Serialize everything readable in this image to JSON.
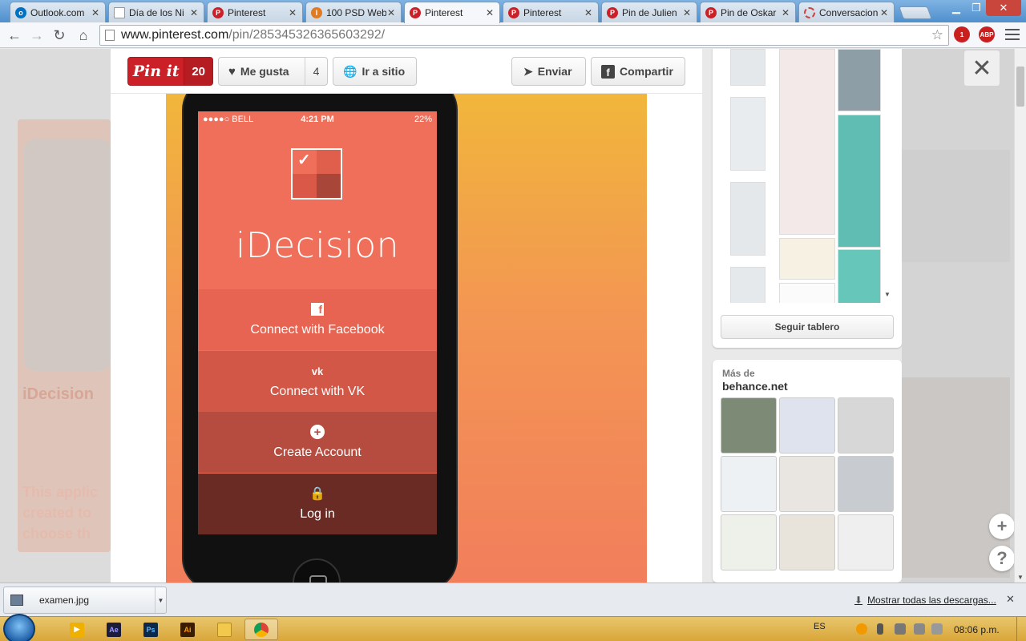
{
  "browser": {
    "tabs": [
      {
        "label": "Outlook.com",
        "icon": "outlook-icon",
        "color": "#0072c6"
      },
      {
        "label": "Día de los Ni",
        "icon": "page-icon",
        "color": "#999999"
      },
      {
        "label": "Pinterest",
        "icon": "pinterest-icon",
        "color": "#cb2027"
      },
      {
        "label": "100 PSD Web",
        "icon": "site-icon",
        "color": "#e07b24"
      },
      {
        "label": "Pinterest",
        "icon": "pinterest-icon",
        "color": "#cb2027",
        "active": true
      },
      {
        "label": "Pinterest",
        "icon": "pinterest-icon",
        "color": "#cb2027"
      },
      {
        "label": "Pin de Julien",
        "icon": "pinterest-icon",
        "color": "#cb2027"
      },
      {
        "label": "Pin de Oskar",
        "icon": "pinterest-icon",
        "color": "#cb2027"
      },
      {
        "label": "Conversacion",
        "icon": "loading-icon",
        "color": "#cc4444"
      }
    ],
    "url_host": "www.pinterest.com",
    "url_path": "/pin/285345326365603292/",
    "ext_badge": "1",
    "ext_abp": "ABP"
  },
  "pin_actions": {
    "pinit_label": "Pin it",
    "pinit_count": "20",
    "like_label": "Me gusta",
    "like_count": "4",
    "visit_label": "Ir a sitio",
    "send_label": "Enviar",
    "share_label": "Compartir"
  },
  "app_mock": {
    "carrier": "●●●●○ BELL",
    "time": "4:21 PM",
    "battery": "22%",
    "title": "iDecision",
    "menu": [
      {
        "label": "Connect with Facebook",
        "icon": "facebook-icon"
      },
      {
        "label": "Connect with VK",
        "icon": "vk-icon"
      },
      {
        "label": "Create Account",
        "icon": "plus-circle-icon"
      },
      {
        "label": "Log in",
        "icon": "lock-icon"
      }
    ]
  },
  "sidebar": {
    "follow_board": "Seguir tablero",
    "more_from_label": "Más de",
    "more_from_site": "behance.net"
  },
  "background": {
    "ghost_title": "iDecision",
    "ghost_text": "This applic created to choose th"
  },
  "downloads": {
    "file": "examen.jpg",
    "show_all": "Mostrar todas las descargas..."
  },
  "taskbar": {
    "lang": "ES",
    "clock": "08:06 p.m."
  }
}
